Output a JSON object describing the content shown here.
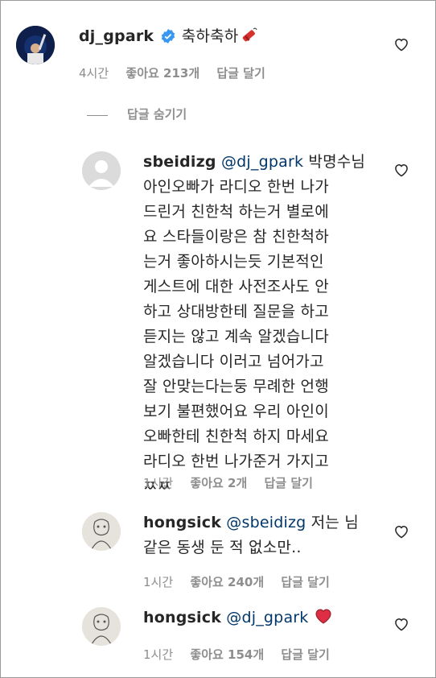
{
  "comments": [
    {
      "username": "dj_gpark",
      "verified": true,
      "text": "축하축하",
      "emoji": "firecracker",
      "time": "4시간",
      "likes": "좋아요 213개",
      "reply": "답글 달기"
    },
    {
      "username": "sbeidizg",
      "mention": "@dj_gpark",
      "lines": [
        " 박명수님",
        "아인오빠가 라디오 한번 나가",
        "드린거 친한척 하는거 별로에",
        "요 스타들이랑은 참 친한척하",
        "는거 좋아하시는듯 기본적인",
        "게스트에 대한 사전조사도 안",
        "하고 상대방한테 질문을 하고",
        "듣지는 않고 계속 알겠습니다",
        "알겠습니다 이러고 넘어가고",
        "잘 안맞는다는둥 무례한 언행",
        "보기 불편했어요 우리 아인이",
        "오빠한테 친한척 하지 마세요",
        "라디오 한번 나가준거 가지고",
        "ㅉㅉ"
      ],
      "time": "1시간",
      "likes": "좋아요 2개",
      "reply": "답글 달기"
    },
    {
      "username": "hongsick",
      "mention": "@sbeidizg",
      "lines": [
        " 저는 님",
        "같은 동생 둔 적 없소만.."
      ],
      "time": "1시간",
      "likes": "좋아요 240개",
      "reply": "답글 달기"
    },
    {
      "username": "hongsick",
      "mention": "@dj_gpark",
      "emoji": "red-heart",
      "time": "1시간",
      "likes": "좋아요 154개",
      "reply": "답글 달기"
    }
  ],
  "hide_replies": "답글 숨기기",
  "colors": {
    "verified": "#3897f0",
    "heart": "#ed4956",
    "meta": "#8e8e8e",
    "mention": "#00376b"
  }
}
